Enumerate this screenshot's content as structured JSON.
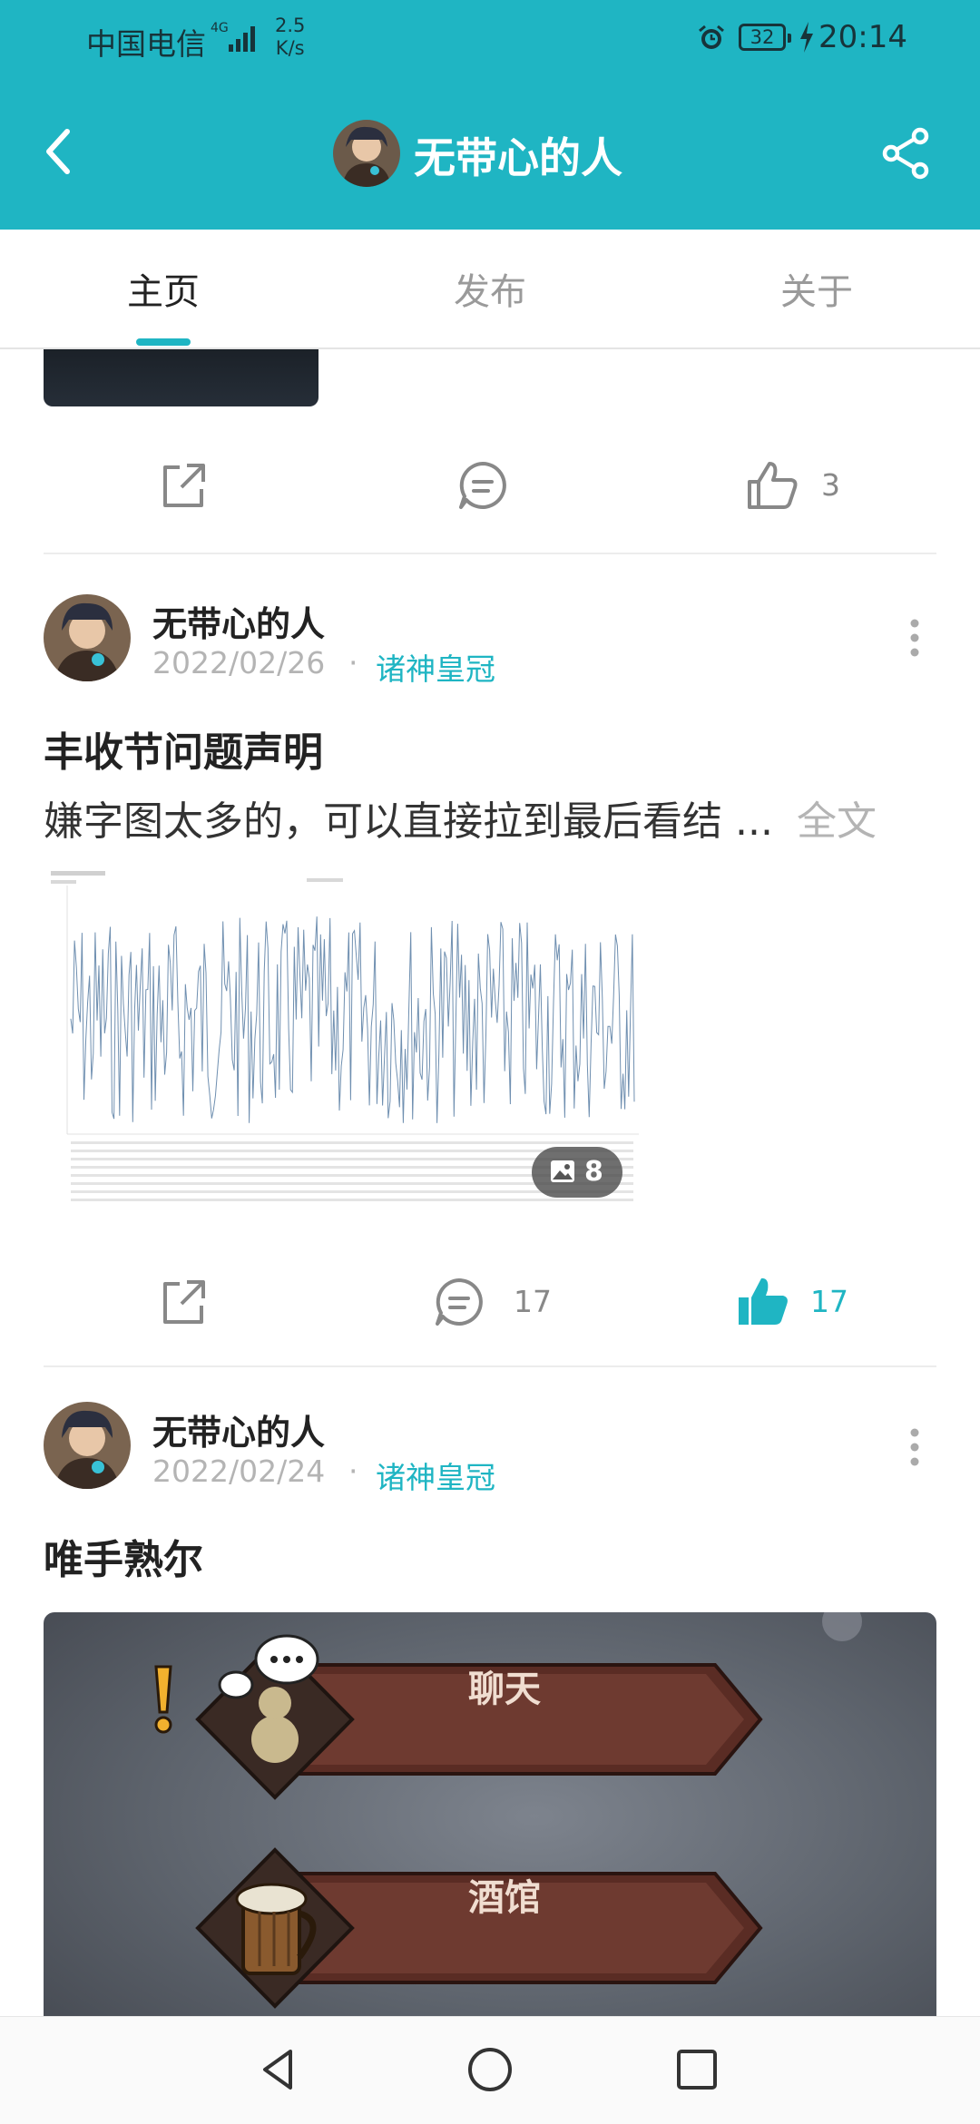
{
  "status_bar": {
    "carrier": "中国电信",
    "network": "4G",
    "speed_value": "2.5",
    "speed_unit": "K/s",
    "battery": "32",
    "time": "20:14"
  },
  "header": {
    "title": "无带心的人",
    "back_icon": "back-arrow-icon",
    "share_icon": "share-icon"
  },
  "tabs": [
    {
      "label": "主页",
      "active": true
    },
    {
      "label": "发布",
      "active": false
    },
    {
      "label": "关于",
      "active": false
    }
  ],
  "feed": {
    "prev_post": {
      "like_count": "3"
    },
    "posts": [
      {
        "author": "无带心的人",
        "date": "2022/02/26",
        "separator": "·",
        "topic": "诸神皇冠",
        "title": "丰收节问题声明",
        "summary": "嫌字图太多的，可以直接拉到最后看结 ...",
        "full_text_label": "全文",
        "image_count": "8",
        "comment_count": "17",
        "like_count": "17",
        "liked": true
      },
      {
        "author": "无带心的人",
        "date": "2022/02/24",
        "separator": "·",
        "topic": "诸神皇冠",
        "title": "唯手熟尔",
        "image_labels": [
          "聊天",
          "酒馆"
        ]
      }
    ]
  },
  "colors": {
    "accent": "#1fb5c3",
    "muted": "#b4b4b4"
  }
}
